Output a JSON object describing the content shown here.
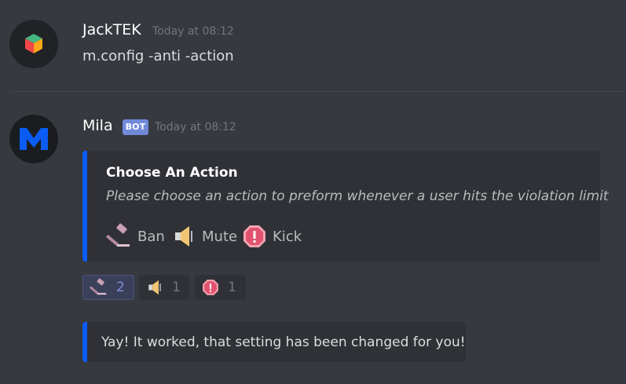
{
  "messages": [
    {
      "username": "JackTEK",
      "timestamp": "Today at 08:12",
      "content": "m.config -anti -action",
      "avatar_icon": "cube-icon"
    },
    {
      "username": "Mila",
      "bot_tag": "BOT",
      "timestamp": "Today at 08:12",
      "avatar_icon": "mila-m-logo",
      "embed": {
        "accent_color": "#0a5cf5",
        "title": "Choose An Action",
        "description": "Please choose an action to preform whenever a user hits the violation limit",
        "options": [
          {
            "icon": "hammer-icon",
            "label": "Ban"
          },
          {
            "icon": "speaker-icon",
            "label": "Mute"
          },
          {
            "icon": "octagonal-sign-icon",
            "label": "Kick"
          }
        ]
      },
      "reactions": [
        {
          "icon": "hammer-icon",
          "count": "2",
          "active": true
        },
        {
          "icon": "speaker-icon",
          "count": "1",
          "active": false
        },
        {
          "icon": "octagonal-sign-icon",
          "count": "1",
          "active": false
        }
      ],
      "followup_embed": {
        "accent_color": "#0a5cf5",
        "text": "Yay! It worked, that setting has been changed for you!"
      }
    }
  ]
}
